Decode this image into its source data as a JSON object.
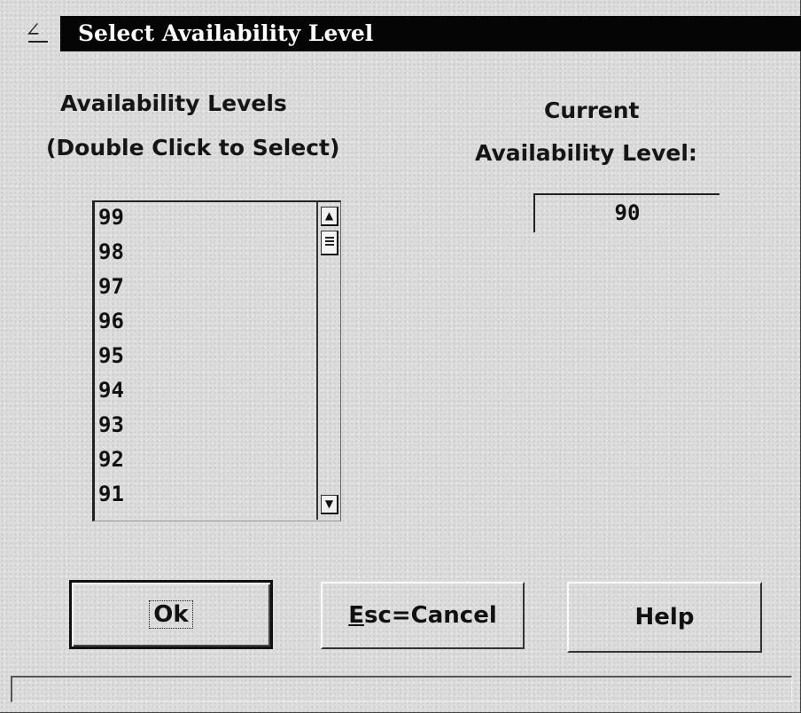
{
  "window": {
    "title": "Select Availability Level",
    "system_menu_glyph": "∠"
  },
  "labels": {
    "levels_heading": "Availability Levels",
    "levels_hint": "(Double Click to Select)",
    "current_line1": "Current",
    "current_line2": "Availability Level:"
  },
  "levels_list": {
    "items": [
      "99",
      "98",
      "97",
      "96",
      "95",
      "94",
      "93",
      "92",
      "91"
    ],
    "scroll_up_glyph": "▲",
    "scroll_down_glyph": "▼"
  },
  "current_level": {
    "value": "90"
  },
  "buttons": {
    "ok": "Ok",
    "cancel_mnemonic": "E",
    "cancel_rest": "sc=Cancel",
    "help": "Help"
  },
  "status_bar": {
    "text": ""
  }
}
